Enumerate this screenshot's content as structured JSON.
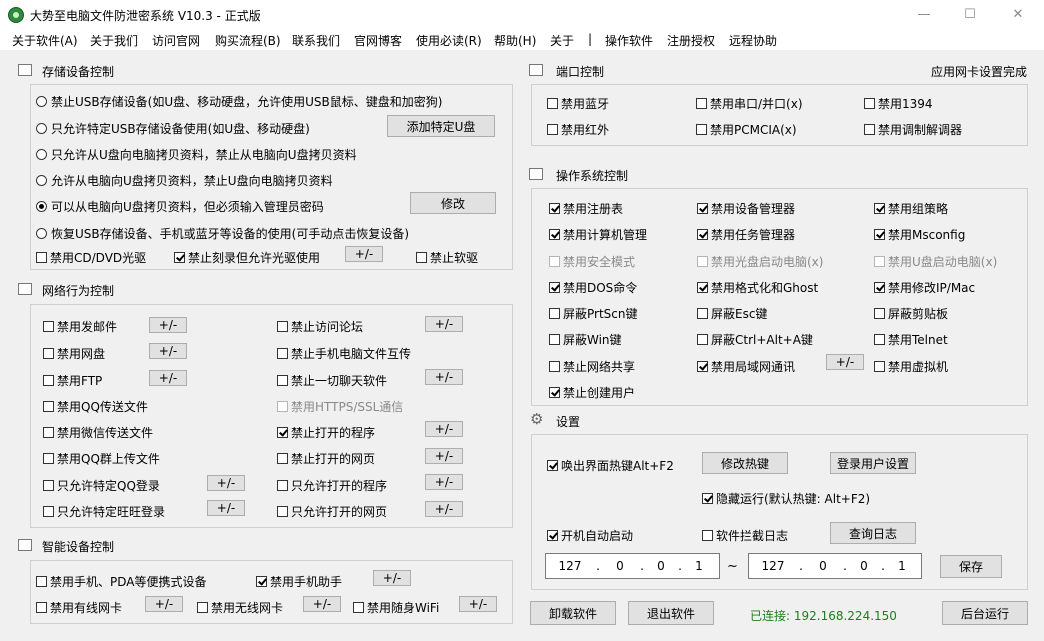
{
  "window": {
    "title": "大势至电脑文件防泄密系统 V10.3 - 正式版",
    "controls": [
      "—",
      "☐",
      "✕"
    ]
  },
  "menu": [
    "关于软件(A)",
    "关于我们",
    "访问官网",
    "购买流程(B)",
    "联系我们",
    "官网博客",
    "使用必读(R)",
    "帮助(H)",
    "关于",
    "|",
    "操作软件",
    "注册授权",
    "远程协助"
  ],
  "storage": {
    "title": "存储设备控制",
    "radios": [
      {
        "label": "禁止USB存储设备(如U盘、移动硬盘，允许使用USB鼠标、键盘和加密狗)",
        "checked": false
      },
      {
        "label": "只允许特定USB存储设备使用(如U盘、移动硬盘)",
        "checked": false
      },
      {
        "label": "只允许从U盘向电脑拷贝资料，禁止从电脑向U盘拷贝资料",
        "checked": false
      },
      {
        "label": "允许从电脑向U盘拷贝资料，禁止U盘向电脑拷贝资料",
        "checked": false
      },
      {
        "label": "可以从电脑向U盘拷贝资料，但必须输入管理员密码",
        "checked": true
      },
      {
        "label": "恢复USB存储设备、手机或蓝牙等设备的使用(可手动点击恢复设备)",
        "checked": false
      }
    ],
    "add_usb_button": "添加特定U盘",
    "modify_button": "修改",
    "checks": [
      {
        "label": "禁用CD/DVD光驱",
        "checked": false
      },
      {
        "label": "禁止刻录但允许光驱使用",
        "checked": true
      },
      {
        "label": "禁止软驱",
        "checked": false
      }
    ],
    "pm_label": "+/-"
  },
  "network": {
    "title": "网络行为控制",
    "left": [
      {
        "label": "禁用发邮件",
        "checked": false,
        "pm": true
      },
      {
        "label": "禁用网盘",
        "checked": false,
        "pm": true
      },
      {
        "label": "禁用FTP",
        "checked": false,
        "pm": true
      },
      {
        "label": "禁用QQ传送文件",
        "checked": false,
        "pm": false
      },
      {
        "label": "禁用微信传送文件",
        "checked": false,
        "pm": false
      },
      {
        "label": "禁用QQ群上传文件",
        "checked": false,
        "pm": false
      },
      {
        "label": "只允许特定QQ登录",
        "checked": false,
        "pm": true
      },
      {
        "label": "只允许特定旺旺登录",
        "checked": false,
        "pm": true
      }
    ],
    "right": [
      {
        "label": "禁止访问论坛",
        "checked": false,
        "pm": true,
        "disabled": false
      },
      {
        "label": "禁止手机电脑文件互传",
        "checked": false,
        "pm": false,
        "disabled": false
      },
      {
        "label": "禁止一切聊天软件",
        "checked": false,
        "pm": true,
        "disabled": false
      },
      {
        "label": "禁用HTTPS/SSL通信",
        "checked": false,
        "pm": false,
        "disabled": true
      },
      {
        "label": "禁止打开的程序",
        "checked": true,
        "pm": true,
        "disabled": false
      },
      {
        "label": "禁止打开的网页",
        "checked": false,
        "pm": true,
        "disabled": false
      },
      {
        "label": "只允许打开的程序",
        "checked": false,
        "pm": true,
        "disabled": false
      },
      {
        "label": "只允许打开的网页",
        "checked": false,
        "pm": true,
        "disabled": false
      }
    ],
    "pm_label": "+/-"
  },
  "smart": {
    "title": "智能设备控制",
    "checks": [
      {
        "label": "禁用手机、PDA等便携式设备",
        "checked": false,
        "pm": false
      },
      {
        "label": "禁用手机助手",
        "checked": true,
        "pm": true
      },
      {
        "label": "禁用有线网卡",
        "checked": false,
        "pm": true
      },
      {
        "label": "禁用无线网卡",
        "checked": false,
        "pm": true
      },
      {
        "label": "禁用随身WiFi",
        "checked": false,
        "pm": true
      }
    ],
    "pm_label": "+/-"
  },
  "port": {
    "title": "端口控制",
    "status": "应用网卡设置完成",
    "checks": [
      {
        "label": "禁用蓝牙",
        "checked": false
      },
      {
        "label": "禁用串口/并口(x)",
        "checked": false
      },
      {
        "label": "禁用1394",
        "checked": false
      },
      {
        "label": "禁用红外",
        "checked": false
      },
      {
        "label": "禁用PCMCIA(x)",
        "checked": false
      },
      {
        "label": "禁用调制解调器",
        "checked": false
      }
    ]
  },
  "os": {
    "title": "操作系统控制",
    "checks": [
      {
        "label": "禁用注册表",
        "checked": true,
        "disabled": false
      },
      {
        "label": "禁用设备管理器",
        "checked": true,
        "disabled": false
      },
      {
        "label": "禁用组策略",
        "checked": true,
        "disabled": false
      },
      {
        "label": "禁用计算机管理",
        "checked": true,
        "disabled": false
      },
      {
        "label": "禁用任务管理器",
        "checked": true,
        "disabled": false
      },
      {
        "label": "禁用Msconfig",
        "checked": true,
        "disabled": false
      },
      {
        "label": "禁用安全模式",
        "checked": false,
        "disabled": true
      },
      {
        "label": "禁用光盘启动电脑(x)",
        "checked": false,
        "disabled": true
      },
      {
        "label": "禁用U盘启动电脑(x)",
        "checked": false,
        "disabled": true
      },
      {
        "label": "禁用DOS命令",
        "checked": true,
        "disabled": false
      },
      {
        "label": "禁用格式化和Ghost",
        "checked": true,
        "disabled": false
      },
      {
        "label": "禁用修改IP/Mac",
        "checked": true,
        "disabled": false
      },
      {
        "label": "屏蔽PrtScn键",
        "checked": false,
        "disabled": false
      },
      {
        "label": "屏蔽Esc键",
        "checked": false,
        "disabled": false
      },
      {
        "label": "屏蔽剪贴板",
        "checked": false,
        "disabled": false
      },
      {
        "label": "屏蔽Win键",
        "checked": false,
        "disabled": false
      },
      {
        "label": "屏蔽Ctrl+Alt+A键",
        "checked": false,
        "disabled": false
      },
      {
        "label": "禁用Telnet",
        "checked": false,
        "disabled": false
      },
      {
        "label": "禁止网络共享",
        "checked": false,
        "disabled": false
      },
      {
        "label": "禁用局域网通讯",
        "checked": true,
        "disabled": false
      },
      {
        "label": "禁用虚拟机",
        "checked": false,
        "disabled": false
      },
      {
        "label": "禁止创建用户",
        "checked": true,
        "disabled": false
      }
    ],
    "pm_label": "+/-"
  },
  "settings": {
    "title": "设置",
    "hotkey_check": {
      "label": "唤出界面热键Alt+F2",
      "checked": true
    },
    "modify_hotkey_button": "修改热键",
    "login_user_button": "登录用户设置",
    "hidden_run_check": {
      "label": "隐藏运行(默认热键: Alt+F2)",
      "checked": true
    },
    "autostart_check": {
      "label": "开机自动启动",
      "checked": true
    },
    "intercept_log_check": {
      "label": "软件拦截日志",
      "checked": false
    },
    "view_log_button": "查询日志",
    "ip_from": [
      "127",
      "0",
      "0",
      "1"
    ],
    "ip_to": [
      "127",
      "0",
      "0",
      "1"
    ],
    "ip_separator": "~",
    "ip_dot": ".",
    "save_button": "保存"
  },
  "footer": {
    "uninstall_button": "卸载软件",
    "exit_button": "退出软件",
    "connection_status": "已连接: 192.168.224.150",
    "background_button": "后台运行"
  }
}
